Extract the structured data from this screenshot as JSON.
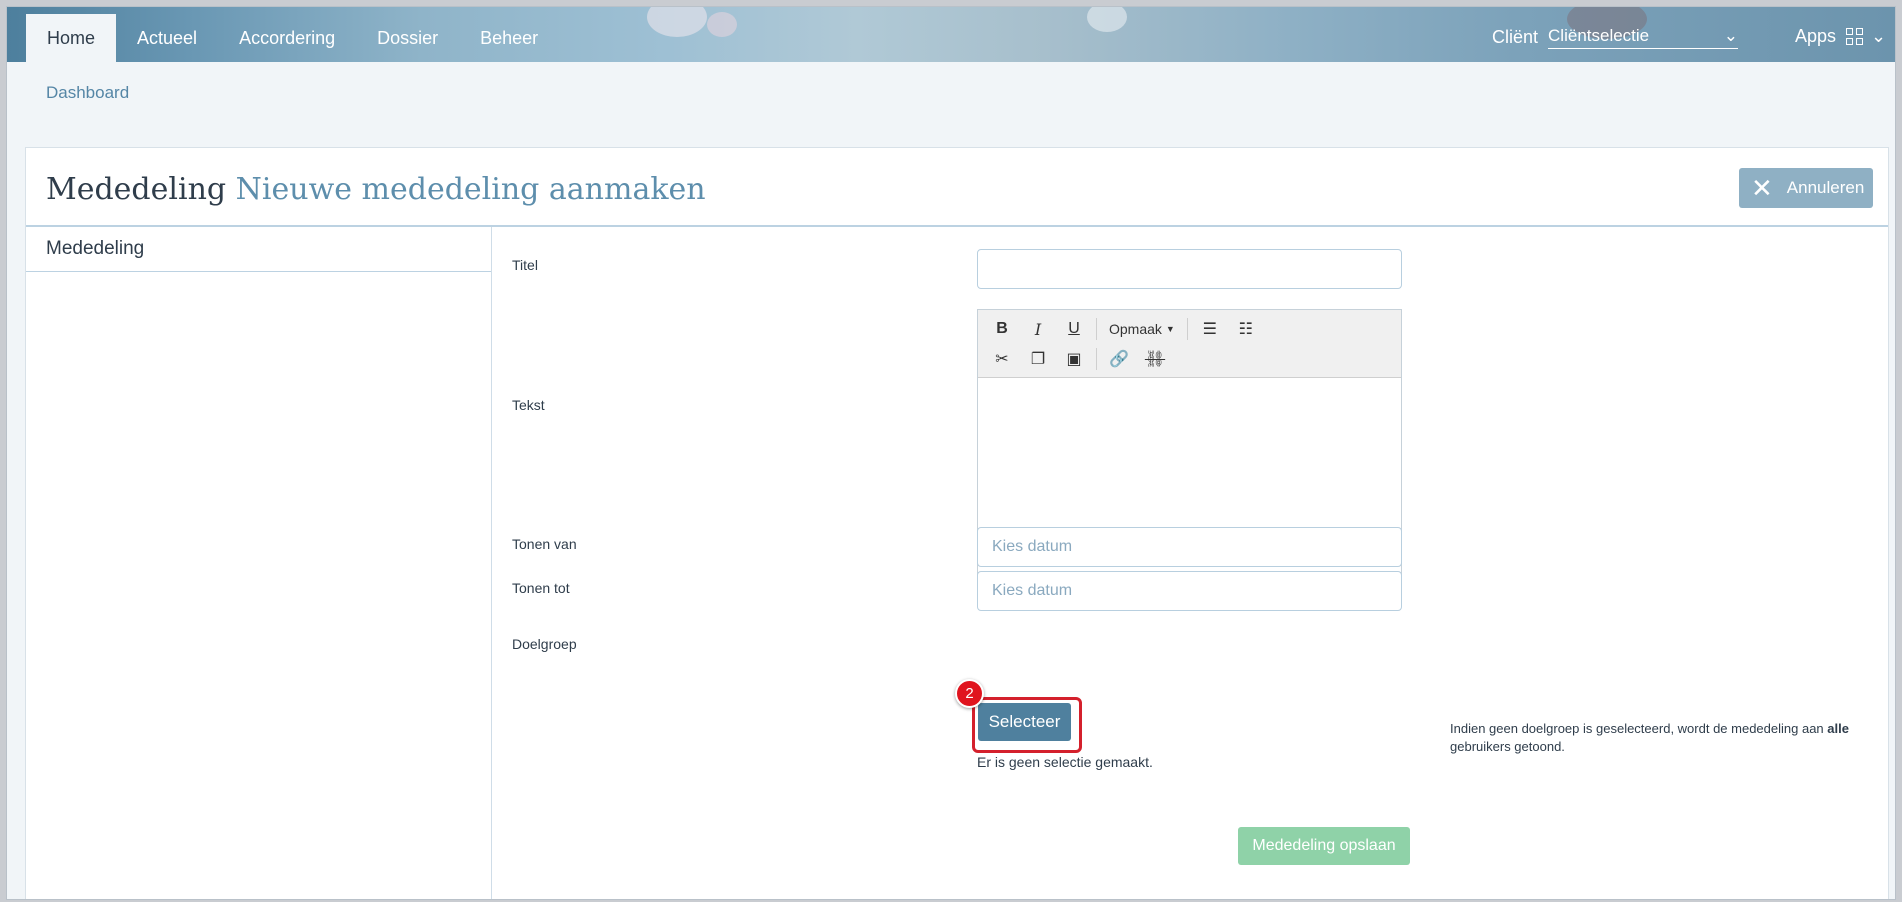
{
  "nav": {
    "items": [
      {
        "label": "Home",
        "active": true
      },
      {
        "label": "Actueel"
      },
      {
        "label": "Accordering"
      },
      {
        "label": "Dossier"
      },
      {
        "label": "Beheer"
      }
    ],
    "client_label": "Cliënt",
    "client_select": "Cliëntselectie",
    "apps_label": "Apps"
  },
  "breadcrumb": "Dashboard",
  "header": {
    "title": "Mededeling",
    "subtitle": "Nieuwe mededeling aanmaken",
    "cancel_label": "Annuleren"
  },
  "sidebar": {
    "items": [
      "Mededeling"
    ]
  },
  "form": {
    "titel_label": "Titel",
    "titel_value": "",
    "tekst_label": "Tekst",
    "editor": {
      "format_label": "Opmaak",
      "tools": [
        "bold-icon",
        "italic-icon",
        "underline-icon",
        "bullet-list-icon",
        "numbered-list-icon",
        "cut-icon",
        "copy-icon",
        "paste-icon",
        "link-icon",
        "unlink-icon"
      ]
    },
    "tonen_van_label": "Tonen van",
    "tonen_van_placeholder": "Kies datum",
    "tonen_tot_label": "Tonen tot",
    "tonen_tot_placeholder": "Kies datum",
    "doelgroep_label": "Doelgroep",
    "select_button": "Selecteer",
    "step_badge": "2",
    "no_selection": "Er is geen selectie gemaakt.",
    "hint_prefix": "Indien geen doelgroep is geselecteerd, wordt de mededeling aan ",
    "hint_bold": "alle",
    "hint_suffix": " gebruikers getoond.",
    "save_button": "Mededeling opslaan"
  },
  "colors": {
    "accent": "#4f809e",
    "save": "#8fd2a8",
    "badge": "#e0141e"
  }
}
